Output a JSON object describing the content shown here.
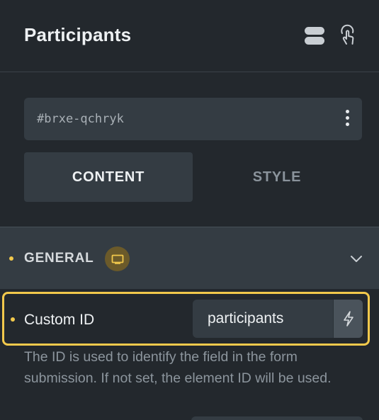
{
  "panel": {
    "title": "Participants",
    "header_icons": [
      "toggle-icon",
      "pointer-hand-icon"
    ]
  },
  "element_id": {
    "value": "#brxe-qchryk",
    "menu_icon": "kebab-icon"
  },
  "tabs": [
    {
      "label": "CONTENT",
      "active": true
    },
    {
      "label": "STYLE",
      "active": false
    }
  ],
  "section": {
    "title": "GENERAL",
    "badge_icon": "monitor-icon",
    "expanded": true
  },
  "custom_id": {
    "label": "Custom ID",
    "value": "participants",
    "dynamic_icon": "lightning-icon",
    "description": "The ID is used to identify the field in the form submission. If not set, the element ID will be used."
  },
  "colors": {
    "accent": "#f2c94c",
    "panel_bg": "#23282d",
    "surface": "#343c43",
    "muted_text": "#8c959d"
  }
}
